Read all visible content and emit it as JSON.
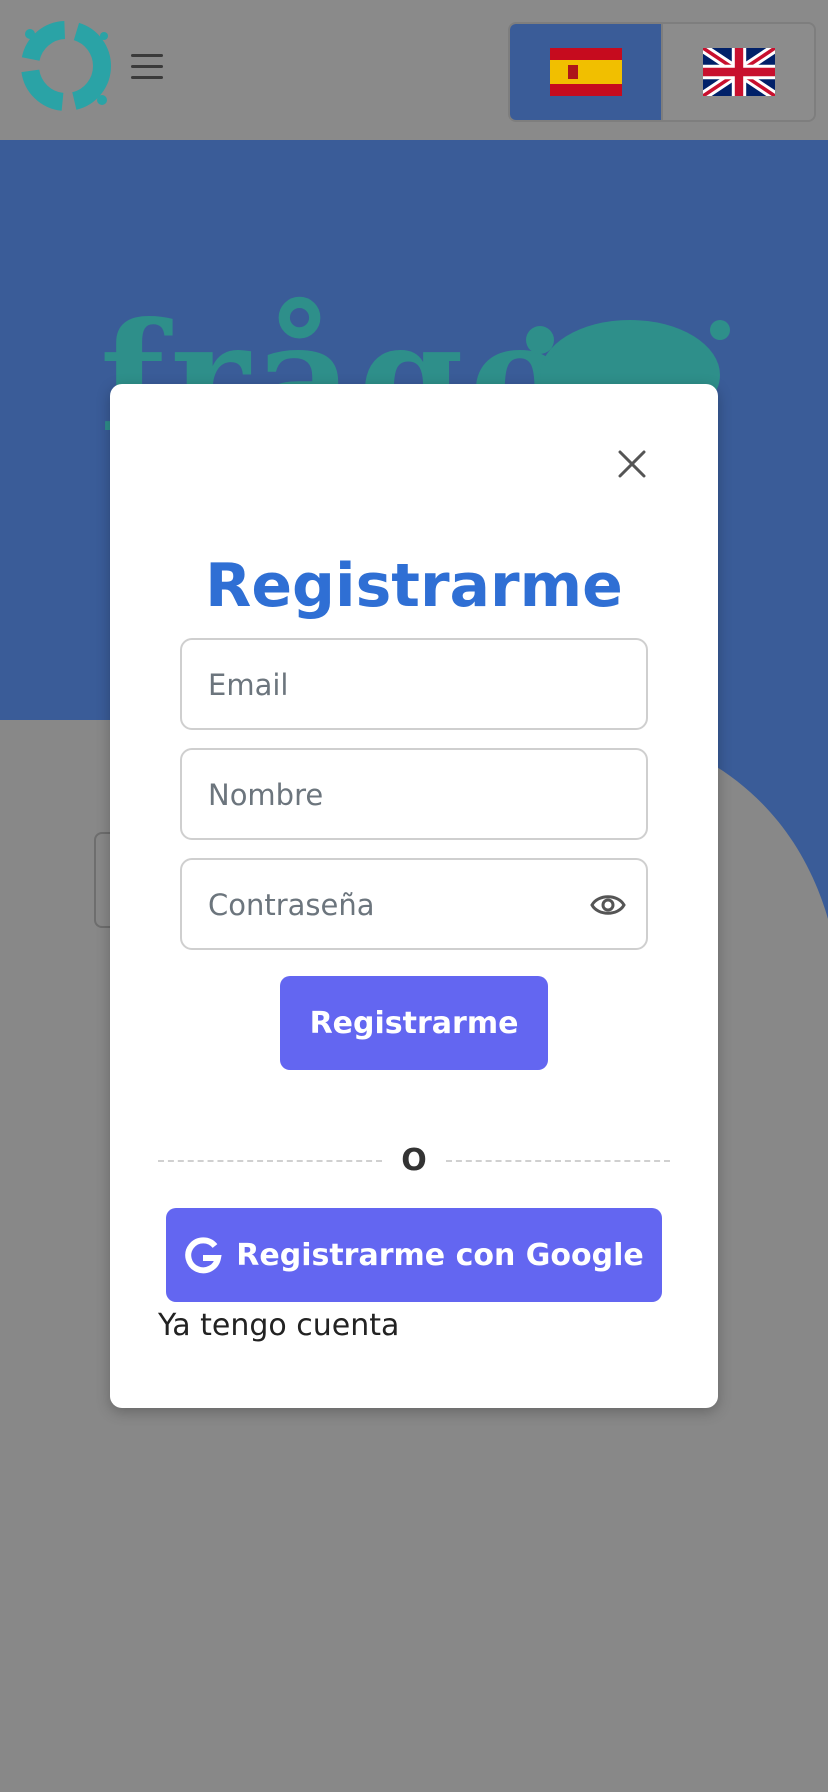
{
  "header": {
    "logo_icon": "splash-logo-icon",
    "menu_icon": "hamburger-menu-icon",
    "languages": [
      {
        "code": "es",
        "icon": "spain-flag-icon",
        "active": true
      },
      {
        "code": "en",
        "icon": "uk-flag-icon",
        "active": false
      }
    ]
  },
  "hero": {
    "text": "frågor"
  },
  "modal": {
    "title": "Registrarme",
    "close_icon": "close-icon",
    "email_placeholder": "Email",
    "name_placeholder": "Nombre",
    "password_placeholder": "Contraseña",
    "password_toggle_icon": "eye-icon",
    "register_button": "Registrarme",
    "divider_text": "O",
    "google_button": "Registrarme con Google",
    "google_icon": "google-g-icon",
    "have_account_link": "Ya tengo cuenta"
  },
  "colors": {
    "primary": "#6366f1",
    "title": "#2f6fd4",
    "hero_bg": "#3a5c98",
    "overlay": "#888888"
  }
}
